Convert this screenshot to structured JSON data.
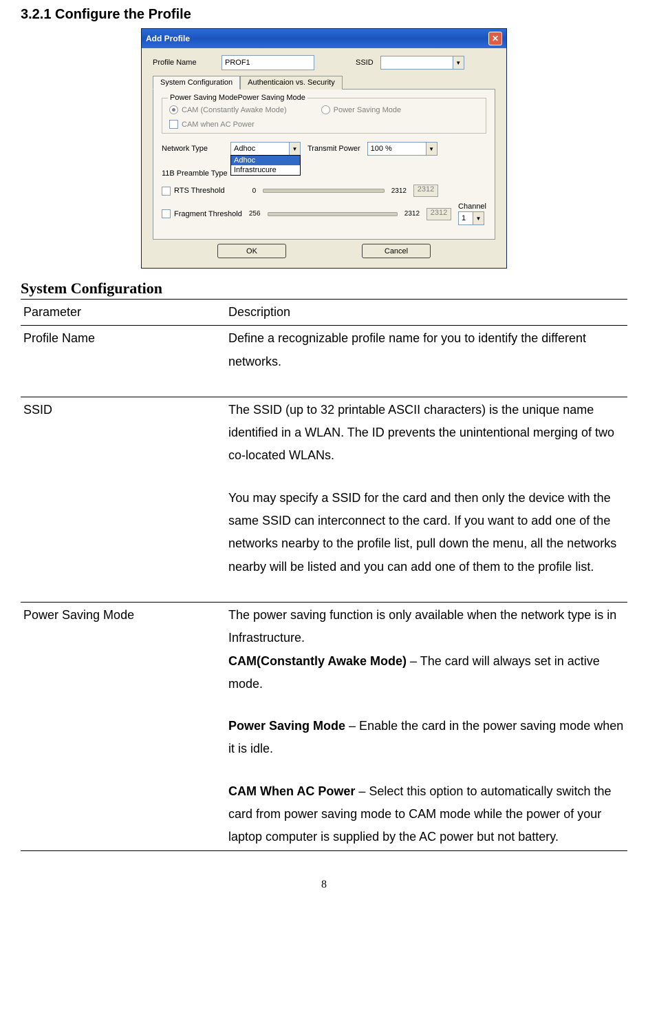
{
  "heading": "3.2.1   Configure the Profile",
  "dialog": {
    "title": "Add Profile",
    "profile_name_label": "Profile Name",
    "profile_name_value": "PROF1",
    "ssid_label": "SSID",
    "ssid_value": "",
    "tabs": {
      "system_config": "System Configuration",
      "auth_sec": "Authenticaion vs. Security"
    },
    "groupbox_title": "Power Saving ModePower Saving Mode",
    "radio_cam": "CAM (Constantly Awake Mode)",
    "radio_psm": "Power Saving Mode",
    "check_cam_ac": "CAM when AC Power",
    "network_type_label": "Network Type",
    "network_type_value": "Adhoc",
    "network_type_options": [
      "Adhoc",
      "Infrastrucure"
    ],
    "transmit_power_label": "Transmit Power",
    "transmit_power_value": "100 %",
    "preamble_label": "11B Preamble Type",
    "rts_label": "RTS Threshold",
    "rts_min": "0",
    "rts_max": "2312",
    "rts_value": "2312",
    "frag_label": "Fragment Threshold",
    "frag_min": "256",
    "frag_max": "2312",
    "frag_value": "2312",
    "channel_label": "Channel",
    "channel_value": "1",
    "ok": "OK",
    "cancel": "Cancel"
  },
  "system_config_heading": "System Configuration",
  "table": {
    "header_param": "Parameter",
    "header_desc": "Description",
    "rows": [
      {
        "param": "Profile Name",
        "desc_parts": [
          {
            "text": "Define a recognizable profile name for you to identify the different networks."
          }
        ]
      },
      {
        "param": "SSID",
        "desc_parts": [
          {
            "text": "The SSID (up to 32 printable ASCII characters) is the unique name identified in a WLAN. The ID prevents the unintentional merging of two co-located WLANs."
          },
          {
            "spacer": true
          },
          {
            "text": "You may specify a SSID for the card and then only the device with the same SSID can interconnect to the card. If you want to add one of the networks nearby to the profile list, pull down the menu, all the networks nearby will be listed and you can add one of them to the profile list."
          }
        ]
      },
      {
        "param": "Power Saving Mode",
        "desc_parts": [
          {
            "text": "The power saving function is only available when the network type is in Infrastructure."
          },
          {
            "bold": "CAM(Constantly Awake Mode)",
            "text": " – The card will always set in active mode."
          },
          {
            "spacer": true
          },
          {
            "bold": "Power Saving Mode",
            "text": " – Enable the card in the power saving mode when it is idle."
          },
          {
            "spacer": true
          },
          {
            "bold": "CAM When AC Power",
            "text": " – Select this option to automatically switch the card from power saving mode to CAM mode while the power of your laptop computer is supplied by the AC power but not battery."
          }
        ]
      }
    ]
  },
  "page_number": "8"
}
